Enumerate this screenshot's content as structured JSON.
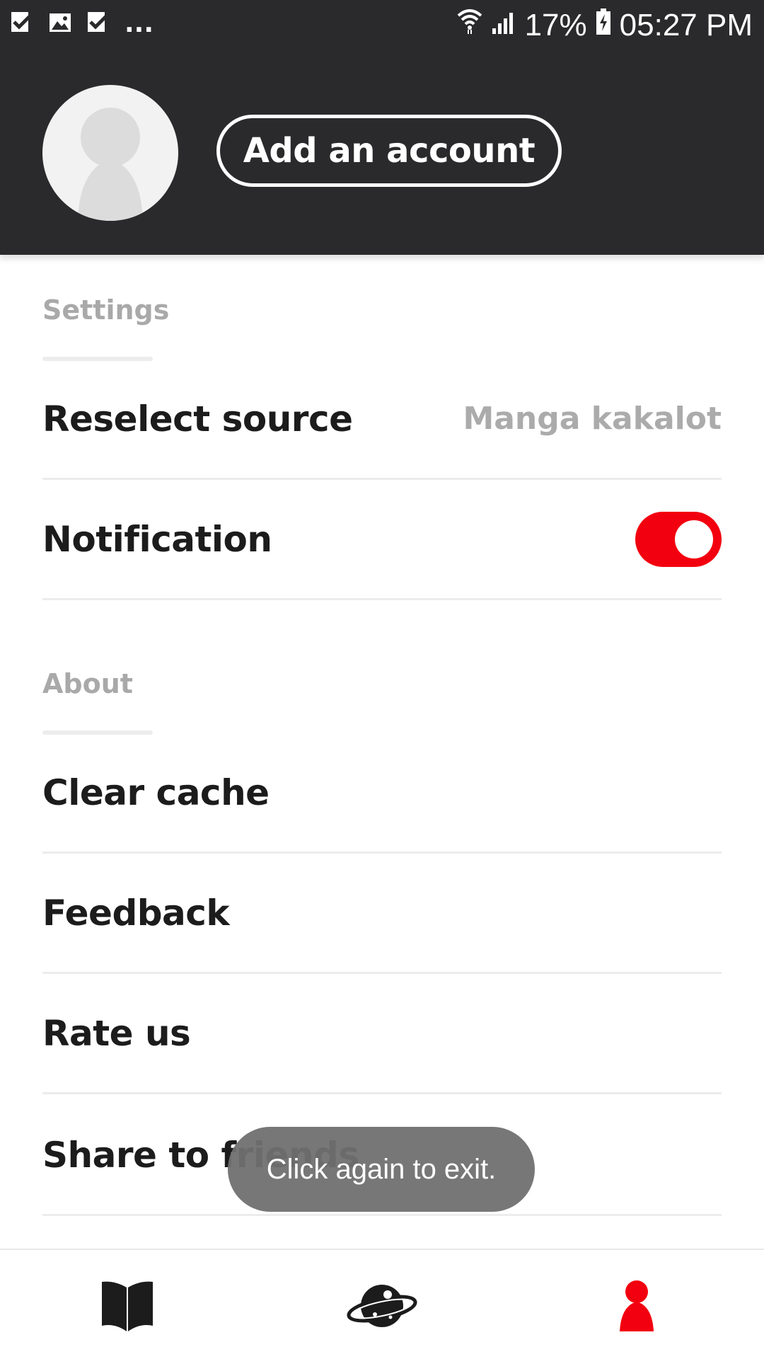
{
  "status_bar": {
    "left_icons": [
      "check-notification-icon",
      "image-notification-icon",
      "check-notification-icon"
    ],
    "overflow": "...",
    "right_icons": [
      "wifi-icon",
      "signal-icon"
    ],
    "battery": "17%",
    "battery_icon": "battery-charging-icon",
    "time": "05:27 PM"
  },
  "header": {
    "avatar_icon": "user-placeholder-icon",
    "add_account_label": "Add an account"
  },
  "settings": {
    "title": "Settings",
    "reselect_source_label": "Reselect source",
    "reselect_source_value": "Manga kakalot",
    "notification_label": "Notification",
    "notification_enabled": true
  },
  "about": {
    "title": "About",
    "items": [
      {
        "label": "Clear cache"
      },
      {
        "label": "Feedback"
      },
      {
        "label": "Rate us"
      },
      {
        "label": "Share to friends"
      }
    ]
  },
  "toast": {
    "message": "Click again to exit."
  },
  "bottom_nav": {
    "items": [
      {
        "icon": "book-icon",
        "active": false
      },
      {
        "icon": "planet-icon",
        "active": false
      },
      {
        "icon": "person-icon",
        "active": true
      }
    ]
  },
  "colors": {
    "header_bg": "#2a2a2c",
    "accent_red": "#f2000f",
    "section_title": "#a9a9a9",
    "divider": "#ececec"
  }
}
